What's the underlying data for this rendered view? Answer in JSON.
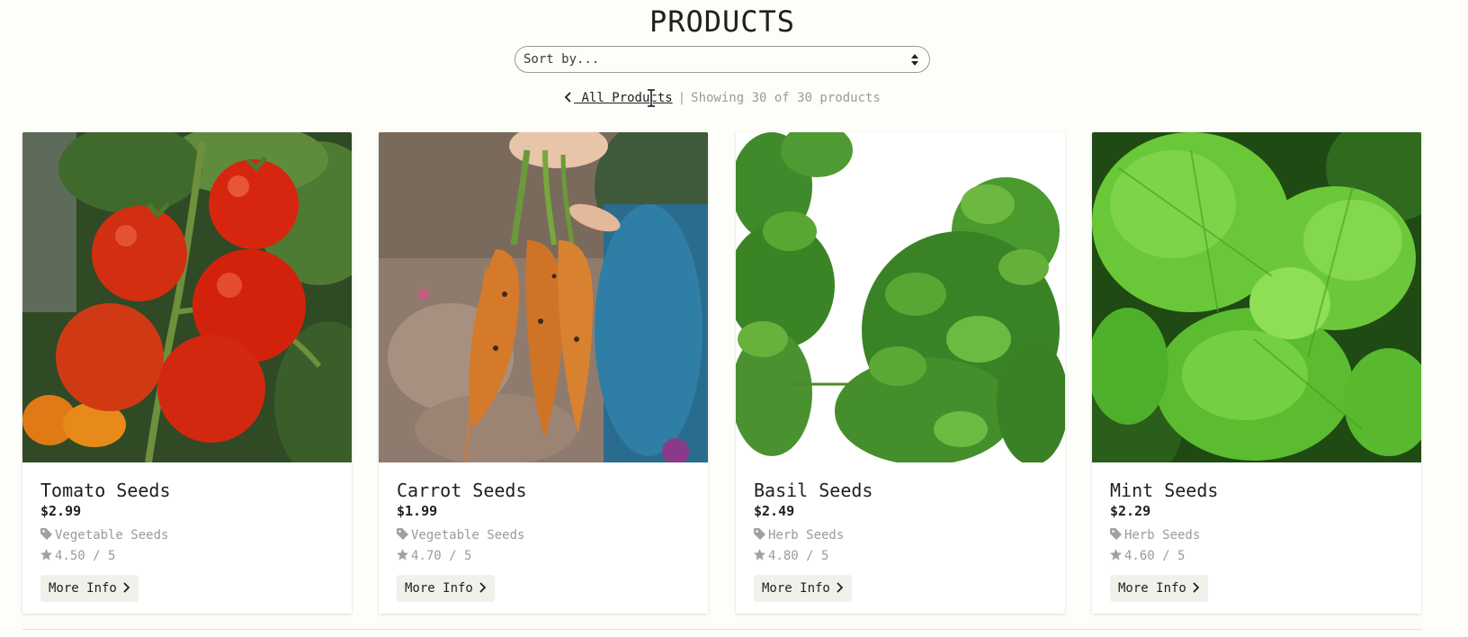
{
  "header": {
    "title": "PRODUCTS"
  },
  "sort": {
    "selected": "Sort by..."
  },
  "nav": {
    "back_label": " All Products",
    "separator": "|",
    "showing": "Showing 30 of 30 products"
  },
  "products": [
    {
      "name": "Tomato Seeds",
      "price": "$2.99",
      "category": "Vegetable Seeds",
      "rating": "4.50 / 5",
      "more_label": "More Info"
    },
    {
      "name": "Carrot Seeds",
      "price": "$1.99",
      "category": "Vegetable Seeds",
      "rating": "4.70 / 5",
      "more_label": "More Info"
    },
    {
      "name": "Basil Seeds",
      "price": "$2.49",
      "category": "Herb Seeds",
      "rating": "4.80 / 5",
      "more_label": "More Info"
    },
    {
      "name": "Mint Seeds",
      "price": "$2.29",
      "category": "Herb Seeds",
      "rating": "4.60 / 5",
      "more_label": "More Info"
    }
  ],
  "colors": {
    "background": "#fdfdf9",
    "muted_text": "#9a9a9a",
    "button_bg": "#f1f0ea"
  }
}
